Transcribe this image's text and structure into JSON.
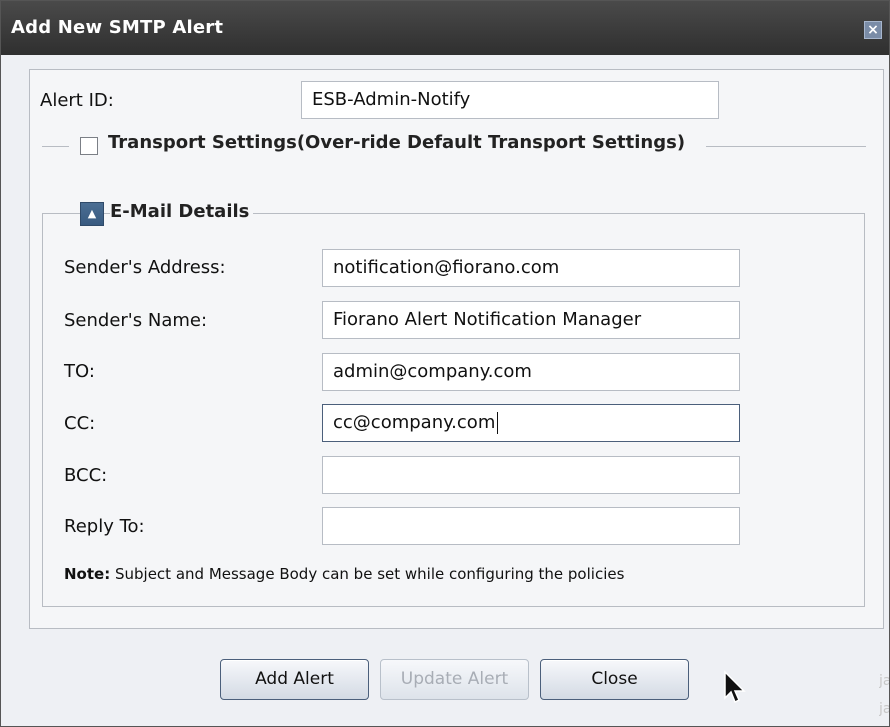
{
  "window": {
    "title": "Add New SMTP Alert",
    "close_icon": "close-icon"
  },
  "alert": {
    "label": "Alert ID:",
    "value": "ESB-Admin-Notify"
  },
  "transport": {
    "label": "Transport Settings(Over-ride Default Transport Settings)",
    "checked": false
  },
  "email": {
    "section_label": "E-Mail Details",
    "collapse_icon": "collapse-up-icon",
    "fields": [
      {
        "label": "Sender's Address:",
        "value": "notification@fiorano.com"
      },
      {
        "label": "Sender's Name:",
        "value": "Fiorano Alert Notification Manager"
      },
      {
        "label": "TO:",
        "value": "admin@company.com"
      },
      {
        "label": "CC:",
        "value": "cc@company.com"
      },
      {
        "label": "BCC:",
        "value": ""
      },
      {
        "label": "Reply To:",
        "value": ""
      }
    ],
    "note_bold": "Note:",
    "note_text": "Subject and Message Body can be set while configuring the policies"
  },
  "buttons": {
    "add": "Add Alert",
    "update": "Update Alert",
    "close": "Close"
  },
  "cursor": {
    "icon": "mouse-pointer-icon"
  },
  "colors": {
    "title_bg": "#3a3a3a",
    "accent_blue": "#4b6e93",
    "panel_bg": "#f5f6f8"
  },
  "edge": {
    "text_top": "ja",
    "text_bottom": "ja"
  }
}
